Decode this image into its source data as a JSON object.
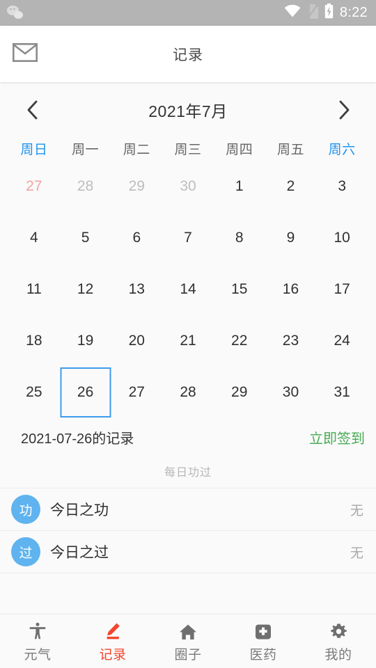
{
  "statusbar": {
    "notification_icon": "wechat-icon",
    "wifi_icon": "wifi-icon",
    "sim_icon": "sim-card-off-icon",
    "battery_icon": "battery-charging-icon",
    "time": "8:22"
  },
  "titlebar": {
    "mail_icon": "mail-icon",
    "title": "记录"
  },
  "calendar": {
    "prev_icon": "chevron-left-icon",
    "next_icon": "chevron-right-icon",
    "month_label": "2021年7月",
    "weekdays": [
      {
        "label": "周日",
        "weekend": true
      },
      {
        "label": "周一",
        "weekend": false
      },
      {
        "label": "周二",
        "weekend": false
      },
      {
        "label": "周三",
        "weekend": false
      },
      {
        "label": "周四",
        "weekend": false
      },
      {
        "label": "周五",
        "weekend": false
      },
      {
        "label": "周六",
        "weekend": true
      }
    ],
    "selected_accent": "#3d9ced",
    "weekend_accent": "#1b93ec",
    "weeks": [
      [
        {
          "d": "27",
          "other": true,
          "red": true,
          "sel": false
        },
        {
          "d": "28",
          "other": true,
          "red": false,
          "sel": false
        },
        {
          "d": "29",
          "other": true,
          "red": false,
          "sel": false
        },
        {
          "d": "30",
          "other": true,
          "red": false,
          "sel": false
        },
        {
          "d": "1",
          "other": false,
          "red": false,
          "sel": false
        },
        {
          "d": "2",
          "other": false,
          "red": false,
          "sel": false
        },
        {
          "d": "3",
          "other": false,
          "red": false,
          "sel": false
        }
      ],
      [
        {
          "d": "4",
          "other": false,
          "red": false,
          "sel": false
        },
        {
          "d": "5",
          "other": false,
          "red": false,
          "sel": false
        },
        {
          "d": "6",
          "other": false,
          "red": false,
          "sel": false
        },
        {
          "d": "7",
          "other": false,
          "red": false,
          "sel": false
        },
        {
          "d": "8",
          "other": false,
          "red": false,
          "sel": false
        },
        {
          "d": "9",
          "other": false,
          "red": false,
          "sel": false
        },
        {
          "d": "10",
          "other": false,
          "red": false,
          "sel": false
        }
      ],
      [
        {
          "d": "11",
          "other": false,
          "red": false,
          "sel": false
        },
        {
          "d": "12",
          "other": false,
          "red": false,
          "sel": false
        },
        {
          "d": "13",
          "other": false,
          "red": false,
          "sel": false
        },
        {
          "d": "14",
          "other": false,
          "red": false,
          "sel": false
        },
        {
          "d": "15",
          "other": false,
          "red": false,
          "sel": false
        },
        {
          "d": "16",
          "other": false,
          "red": false,
          "sel": false
        },
        {
          "d": "17",
          "other": false,
          "red": false,
          "sel": false
        }
      ],
      [
        {
          "d": "18",
          "other": false,
          "red": false,
          "sel": false
        },
        {
          "d": "19",
          "other": false,
          "red": false,
          "sel": false
        },
        {
          "d": "20",
          "other": false,
          "red": false,
          "sel": false
        },
        {
          "d": "21",
          "other": false,
          "red": false,
          "sel": false
        },
        {
          "d": "22",
          "other": false,
          "red": false,
          "sel": false
        },
        {
          "d": "23",
          "other": false,
          "red": false,
          "sel": false
        },
        {
          "d": "24",
          "other": false,
          "red": false,
          "sel": false
        }
      ],
      [
        {
          "d": "25",
          "other": false,
          "red": false,
          "sel": false
        },
        {
          "d": "26",
          "other": false,
          "red": false,
          "sel": true
        },
        {
          "d": "27",
          "other": false,
          "red": false,
          "sel": false
        },
        {
          "d": "28",
          "other": false,
          "red": false,
          "sel": false
        },
        {
          "d": "29",
          "other": false,
          "red": false,
          "sel": false
        },
        {
          "d": "30",
          "other": false,
          "red": false,
          "sel": false
        },
        {
          "d": "31",
          "other": false,
          "red": false,
          "sel": false
        }
      ]
    ]
  },
  "record": {
    "date_label": "2021-07-26的记录",
    "signin_label": "立即签到",
    "signin_color": "#45ab52",
    "section_label": "每日功过",
    "items": [
      {
        "badge": "功",
        "label": "今日之功",
        "value": "无"
      },
      {
        "badge": "过",
        "label": "今日之过",
        "value": "无"
      }
    ],
    "badge_color": "#5fb3ef"
  },
  "bottomnav": {
    "active_color": "#f4442e",
    "items": [
      {
        "icon": "accessibility-person-icon",
        "label": "元气",
        "active": false
      },
      {
        "icon": "pencil-edit-icon",
        "label": "记录",
        "active": true
      },
      {
        "icon": "home-icon",
        "label": "圈子",
        "active": false
      },
      {
        "icon": "medical-kit-icon",
        "label": "医药",
        "active": false
      },
      {
        "icon": "gear-icon",
        "label": "我的",
        "active": false
      }
    ]
  }
}
